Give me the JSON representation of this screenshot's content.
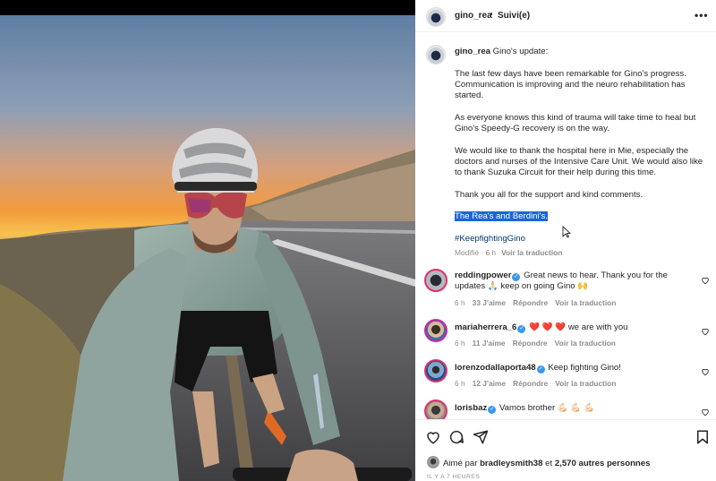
{
  "post": {
    "author": "gino_rea",
    "follow_status": "Suivi(e)",
    "more_label": "•••",
    "caption": {
      "intro": "Gino's update:",
      "p1": "The last few days have been remarkable for Gino's progress. Communication is improving and the neuro rehabilitation has started.",
      "p2": "As everyone knows this kind of trauma will take time to heal but Gino's Speedy-G recovery is on the way.",
      "p3": "We would like to thank the hospital here in Mie, especially the doctors and nurses of the Intensive Care Unit. We would also like to thank Suzuka Circuit for their help during this time.",
      "p4": "Thank you all for the support and kind comments.",
      "signoff": "The Rea's and Berdini's.",
      "hashtag": "#KeepfightingGino"
    },
    "meta": {
      "edited": "Modifié · 6 h",
      "translate": "Voir la traduction"
    }
  },
  "comments": [
    {
      "user": "reddingpower",
      "verified": true,
      "text": "Great news to hear. Thank you for the updates 🙏🏻 keep on going Gino 🙌",
      "time": "6 h",
      "likes": "33 J'aime",
      "reply": "Répondre",
      "translate": "Voir la traduction"
    },
    {
      "user": "mariaherrera_6",
      "verified": true,
      "text": "❤️ ❤️ ❤️ we are with you",
      "time": "6 h",
      "likes": "11 J'aime",
      "reply": "Répondre",
      "translate": "Voir la traduction"
    },
    {
      "user": "lorenzodallaporta48",
      "verified": true,
      "text": "Keep fighting Gino!",
      "time": "6 h",
      "likes": "12 J'aime",
      "reply": "Répondre",
      "translate": "Voir la traduction"
    },
    {
      "user": "lorisbaz",
      "verified": true,
      "text": "Vamos brother 💪🏻 💪🏻 💪🏻"
    }
  ],
  "footer": {
    "liked_by_prefix": "Aimé par",
    "liked_by_user": "bradleysmith38",
    "liked_by_mid": "et",
    "liked_by_count": "2,570 autres personnes",
    "time_ago": "IL Y A 7 HEURES"
  },
  "colors": {
    "highlight": "#1a66d6",
    "hashtag": "#00376b",
    "verified": "#3897f0",
    "muted": "#8e8e8e"
  },
  "icons": [
    "more-icon",
    "heart-icon",
    "comment-icon",
    "share-icon",
    "bookmark-icon",
    "verified-badge-icon",
    "cursor-icon"
  ]
}
